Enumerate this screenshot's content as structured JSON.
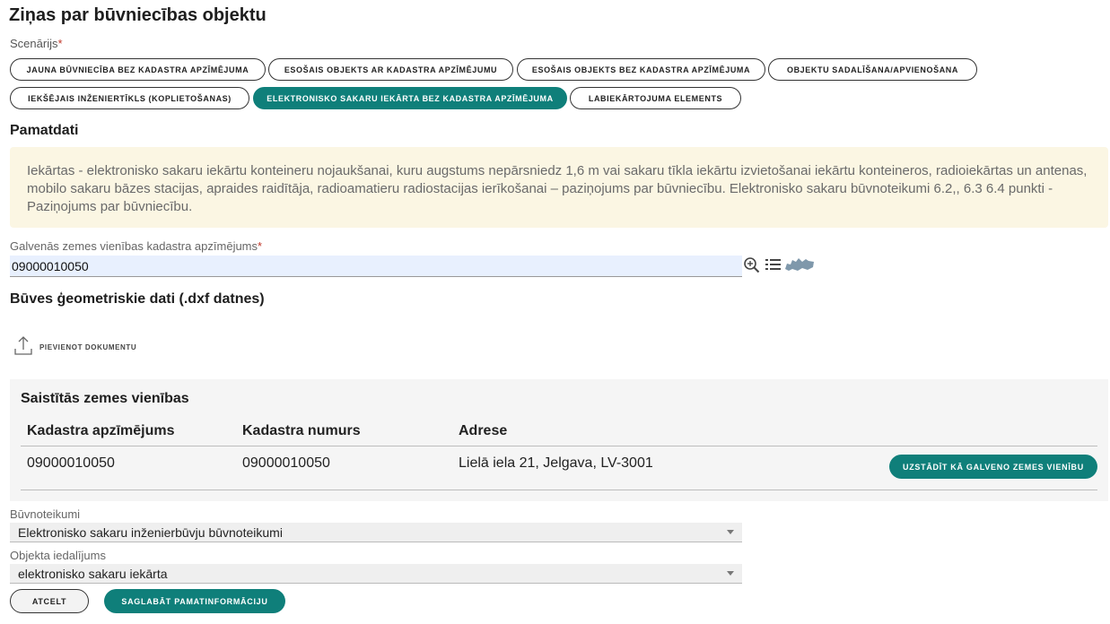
{
  "page": {
    "title": "Ziņas par būvniecības objektu"
  },
  "scenario": {
    "label": "Scenārijs",
    "required_mark": "*",
    "options": [
      "JAUNA BŪVNIECĪBA BEZ KADASTRA APZĪMĒJUMA",
      "ESOŠAIS OBJEKTS AR KADASTRA APZĪMĒJUMU",
      "ESOŠAIS OBJEKTS BEZ KADASTRA APZĪMĒJUMA",
      "OBJEKTU SADALĪŠANA/APVIENOŠANA",
      "IEKŠĒJAIS INŽENIERTĪKLS (KOPLIETOŠANAS)",
      "ELEKTRONISKO SAKARU IEKĀRTA BEZ KADASTRA APZĪMĒJUMA",
      "LABIEKĀRTOJUMA ELEMENTS"
    ],
    "selected_index": 5
  },
  "basics": {
    "heading": "Pamatdati",
    "info_text": "Iekārtas - elektronisko sakaru iekārtu konteineru nojaukšanai, kuru augstums nepārsniedz 1,6 m vai sakaru tīkla iekārtu izvietošanai iekārtu konteineros, radioiekārtas un antenas, mobilo sakaru bāzes stacijas, apraides raidītāja, radioamatieru radiostacijas ierīkošanai – paziņojums par būvniecību. Elektronisko sakaru būvnoteikumi 6.2,, 6.3 6.4 punkti - Paziņojums par būvniecību."
  },
  "cadastre": {
    "label": "Galvenās zemes vienības kadastra apzīmējums",
    "required_mark": "*",
    "value": "09000010050",
    "icons": [
      "zoom-in-icon",
      "list-icon",
      "latvia-map-icon"
    ]
  },
  "geometry": {
    "heading": "Būves ģeometriskie dati (.dxf datnes)",
    "upload_label": "PIEVIENOT DOKUMENTU"
  },
  "linked_units": {
    "heading": "Saistītās zemes vienības",
    "columns": [
      "Kadastra apzīmējums",
      "Kadastra numurs",
      "Adrese"
    ],
    "rows": [
      {
        "designation": "09000010050",
        "number": "09000010050",
        "address": "Lielā iela 21, Jelgava, LV-3001",
        "action": "UZSTĀDĪT KĀ GALVENO ZEMES VIENĪBU"
      }
    ]
  },
  "regulations": {
    "label": "Būvnoteikumi",
    "value": "Elektronisko sakaru inženierbūvju būvnoteikumi"
  },
  "object_division": {
    "label": "Objekta iedalījums",
    "value": "elektronisko sakaru iekārta"
  },
  "actions": {
    "cancel": "ATCELT",
    "save": "SAGLABĀT PAMATINFORMĀCIJU"
  },
  "colors": {
    "accent": "#0f7f7a",
    "info_bg": "#fbf6e3",
    "input_bg": "#e8f0fe",
    "required": "#c0392b"
  }
}
